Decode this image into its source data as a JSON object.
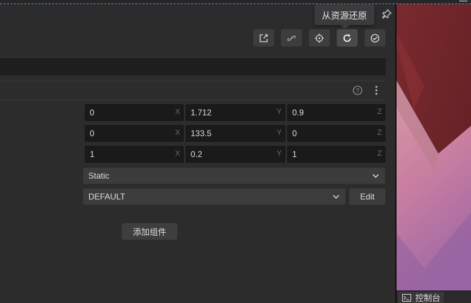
{
  "toolbar": {
    "tooltip": "从资源还原",
    "buttons": [
      {
        "icon": "open-external-icon"
      },
      {
        "icon": "unlink-icon"
      },
      {
        "icon": "locate-icon"
      },
      {
        "icon": "revert-icon",
        "active": true
      },
      {
        "icon": "apply-check-icon"
      }
    ]
  },
  "transform": {
    "position": {
      "x": "0",
      "y": "1.712",
      "z": "0.9"
    },
    "rotation": {
      "x": "0",
      "y": "133.5",
      "z": "0"
    },
    "scale": {
      "x": "1",
      "y": "0.2",
      "z": "1"
    },
    "axis_labels": {
      "x": "X",
      "y": "Y",
      "z": "Z"
    }
  },
  "body_type": {
    "value": "Static"
  },
  "group": {
    "value": "DEFAULT",
    "edit_label": "Edit"
  },
  "add_component_label": "添加组件",
  "console": {
    "label": "控制台"
  },
  "colors": {
    "accent_dash": "#3e8edc",
    "panel": "#2c2c2c",
    "field": "#1a1a1a"
  }
}
